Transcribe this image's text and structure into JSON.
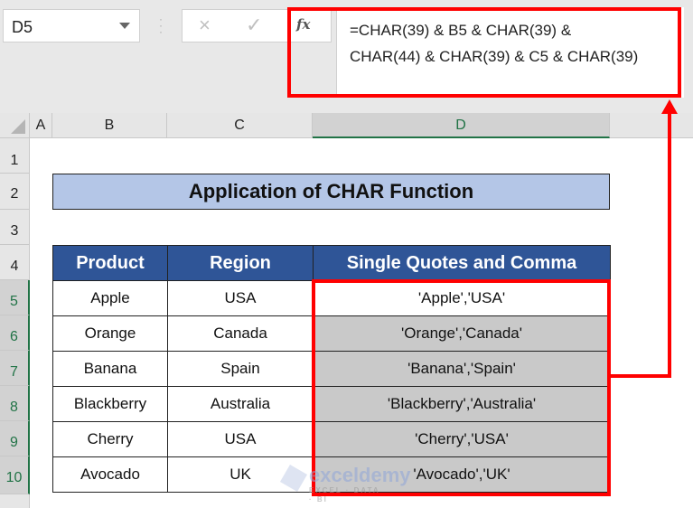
{
  "formula_bar": {
    "name_box": "D5",
    "cancel_icon": "×",
    "enter_icon": "✓",
    "fx_label": "fx",
    "formula_line1": "=CHAR(39) & B5 & CHAR(39) &",
    "formula_line2": "CHAR(44) & CHAR(39) & C5 & CHAR(39)"
  },
  "columns": [
    "A",
    "B",
    "C",
    "D"
  ],
  "rows": [
    "1",
    "2",
    "3",
    "4",
    "5",
    "6",
    "7",
    "8",
    "9",
    "10"
  ],
  "sheet": {
    "title": "Application of CHAR Function",
    "headers": [
      "Product",
      "Region",
      "Single Quotes and Comma"
    ],
    "data": [
      [
        "Apple",
        "USA",
        "'Apple','USA'"
      ],
      [
        "Orange",
        "Canada",
        "'Orange','Canada'"
      ],
      [
        "Banana",
        "Spain",
        "'Banana','Spain'"
      ],
      [
        "Blackberry",
        "Australia",
        "'Blackberry','Australia'"
      ],
      [
        "Cherry",
        "USA",
        "'Cherry','USA'"
      ],
      [
        "Avocado",
        "UK",
        "'Avocado','UK'"
      ]
    ]
  },
  "watermark": {
    "name": "exceldemy",
    "tagline": "EXCEL · DATA · BI"
  },
  "colors": {
    "header_bg": "#2f5597",
    "title_bg": "#b4c6e7",
    "highlight": "#ff0000",
    "selection": "#217346"
  }
}
